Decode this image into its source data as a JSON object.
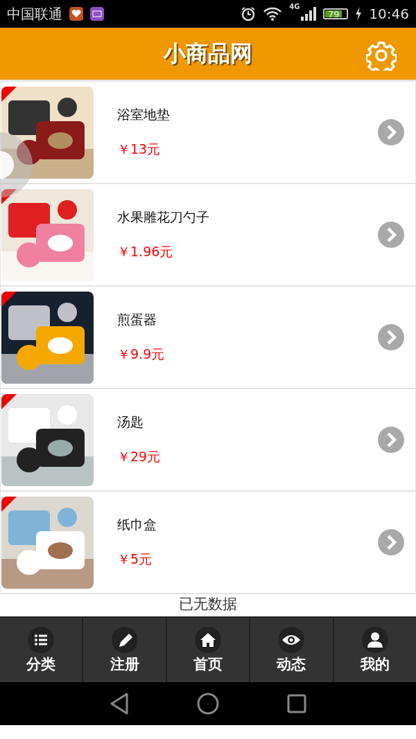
{
  "status_bar": {
    "carrier": "中国联通",
    "network": "4G",
    "battery": "79",
    "time": "10:46"
  },
  "header": {
    "title": "小商品网"
  },
  "products": [
    {
      "name": "浴室地垫",
      "price": "￥13元"
    },
    {
      "name": "水果雕花刀勺子",
      "price": "￥1.96元"
    },
    {
      "name": "煎蛋器",
      "price": "￥9.9元"
    },
    {
      "name": "汤匙",
      "price": "￥29元"
    },
    {
      "name": "纸巾盒",
      "price": "￥5元"
    }
  ],
  "end_message": "已无数据",
  "tab_bar": [
    {
      "kind": "list",
      "label": "分类"
    },
    {
      "kind": "pencil",
      "label": "注册"
    },
    {
      "kind": "home",
      "label": "首页"
    },
    {
      "kind": "eye",
      "label": "动态"
    },
    {
      "kind": "user",
      "label": "我的"
    }
  ]
}
